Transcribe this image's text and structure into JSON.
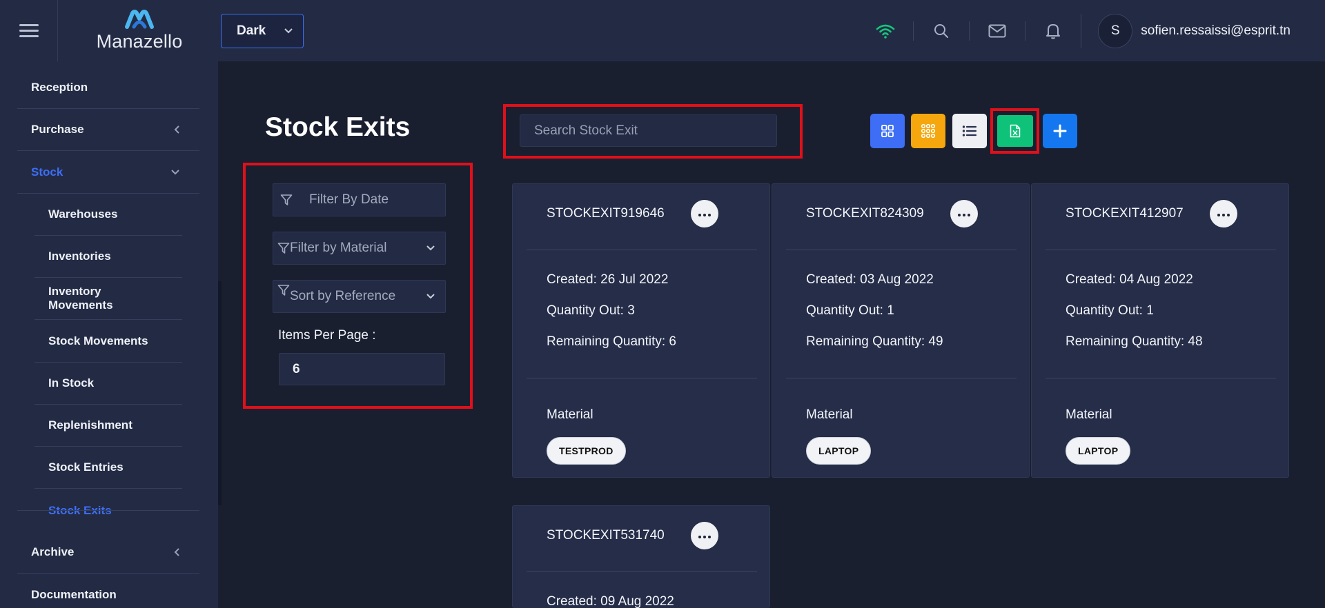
{
  "header": {
    "brand": "Manazello",
    "theme_selected": "Dark",
    "user_initial": "S",
    "user_email": "sofien.ressaissi@esprit.tn"
  },
  "sidebar": {
    "items": [
      {
        "label": "Reception"
      },
      {
        "label": "Purchase"
      },
      {
        "label": "Stock"
      },
      {
        "label": "Warehouses"
      },
      {
        "label": "Inventories"
      },
      {
        "label": "Inventory Movements"
      },
      {
        "label": "Stock Movements"
      },
      {
        "label": "In Stock"
      },
      {
        "label": "Replenishment"
      },
      {
        "label": "Stock Entries"
      },
      {
        "label": "Stock Exits"
      },
      {
        "label": "Archive"
      },
      {
        "label": "Documentation"
      }
    ]
  },
  "page": {
    "title": "Stock Exits",
    "search_placeholder": "Search Stock Exit"
  },
  "filters": {
    "date_placeholder": "Filter By Date",
    "material_placeholder": "Filter by Material",
    "sort_placeholder": "Sort by Reference",
    "items_per_page_label": "Items Per Page :",
    "items_per_page_value": "6"
  },
  "colors": {
    "accent_blue": "#3d6ef5",
    "grid_yellow": "#f5a70d",
    "excel_green": "#0fc27a",
    "highlight_red": "#e0101a"
  },
  "cards": [
    {
      "ref": "STOCKEXIT919646",
      "created": "Created: 26 Jul 2022",
      "qty_out": "Quantity Out: 3",
      "remaining": "Remaining Quantity: 6",
      "material_label": "Material",
      "material": "TESTPROD"
    },
    {
      "ref": "STOCKEXIT824309",
      "created": "Created: 03 Aug 2022",
      "qty_out": "Quantity Out: 1",
      "remaining": "Remaining Quantity: 49",
      "material_label": "Material",
      "material": "LAPTOP"
    },
    {
      "ref": "STOCKEXIT412907",
      "created": "Created: 04 Aug 2022",
      "qty_out": "Quantity Out: 1",
      "remaining": "Remaining Quantity: 48",
      "material_label": "Material",
      "material": "LAPTOP"
    },
    {
      "ref": "STOCKEXIT531740",
      "created": "Created: 09 Aug 2022"
    }
  ]
}
